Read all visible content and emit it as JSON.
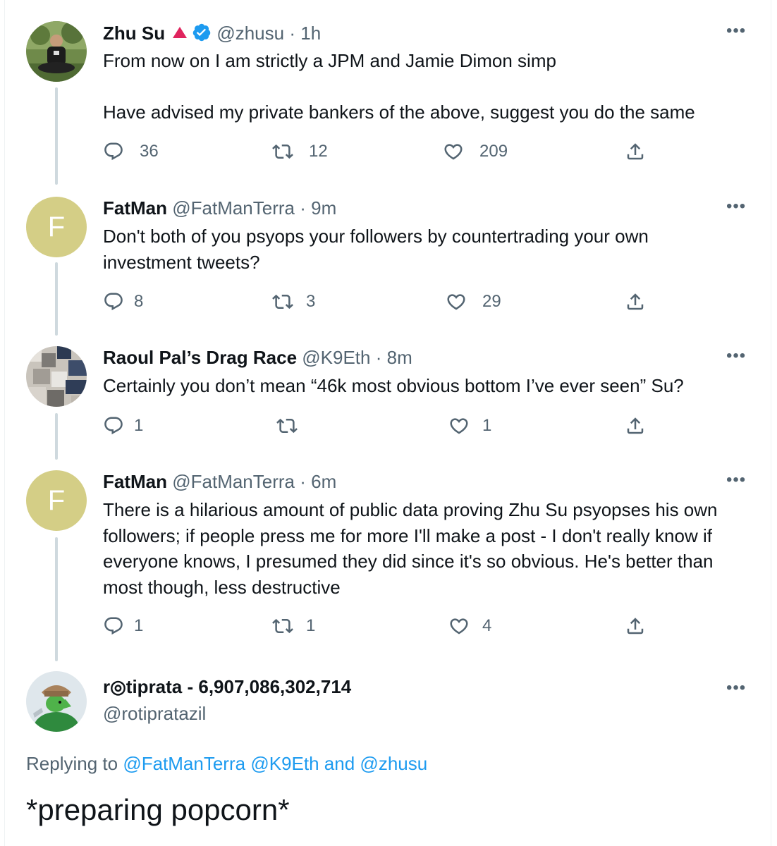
{
  "tweets": [
    {
      "name": "Zhu Su",
      "handle": "@zhusu",
      "time": "1h",
      "text": "From now on I am strictly a JPM and Jamie Dimon simp\n\nHave advised my private bankers of the above, suggest you do the same",
      "replies": "36",
      "retweets": "12",
      "likes": "209"
    },
    {
      "name": "FatMan",
      "handle": "@FatManTerra",
      "time": "9m",
      "avatar_letter": "F",
      "text": "Don't both of you psyops your followers by countertrading your own\ninvestment tweets?",
      "replies": "8",
      "retweets": "3",
      "likes": "29"
    },
    {
      "name": "Raoul Pal’s Drag Race",
      "handle": "@K9Eth",
      "time": "8m",
      "text": "Certainly you don’t mean “46k most obvious bottom I’ve ever seen” Su?",
      "replies": "1",
      "retweets": "",
      "likes": "1"
    },
    {
      "name": "FatMan",
      "handle": "@FatManTerra",
      "time": "6m",
      "avatar_letter": "F",
      "text": "There is a hilarious amount of public data proving Zhu Su psyopses his own\nfollowers; if people press me for more I'll make a post - I don't really know if\neveryone knows, I presumed they did since it's so obvious. He's better than\nmost though, less destructive",
      "replies": "1",
      "retweets": "1",
      "likes": "4"
    }
  ],
  "focus_tweet": {
    "name": "r◎tiprata - 6,907,086,302,714",
    "handle": "@rotipratazil",
    "replying_prefix": "Replying to",
    "replying_handle_1": "@FatManTerra",
    "replying_handle_2": "@K9Eth",
    "replying_and": "and",
    "replying_handle_3": "@zhusu",
    "text": "*preparing popcorn*"
  },
  "separator": "·",
  "more_label": "•••",
  "icons": {
    "reply": "reply-icon",
    "retweet": "retweet-icon",
    "like": "heart-icon",
    "share": "share-icon",
    "verified": "verified-badge-icon",
    "menu": "more-icon"
  },
  "colors": {
    "text": "#0f1419",
    "secondary": "#536471",
    "link": "#1d9bf0",
    "thread_line": "#cfd9de",
    "avatar_bg": "#d4ce86",
    "red_triangle": "#e0245e"
  }
}
